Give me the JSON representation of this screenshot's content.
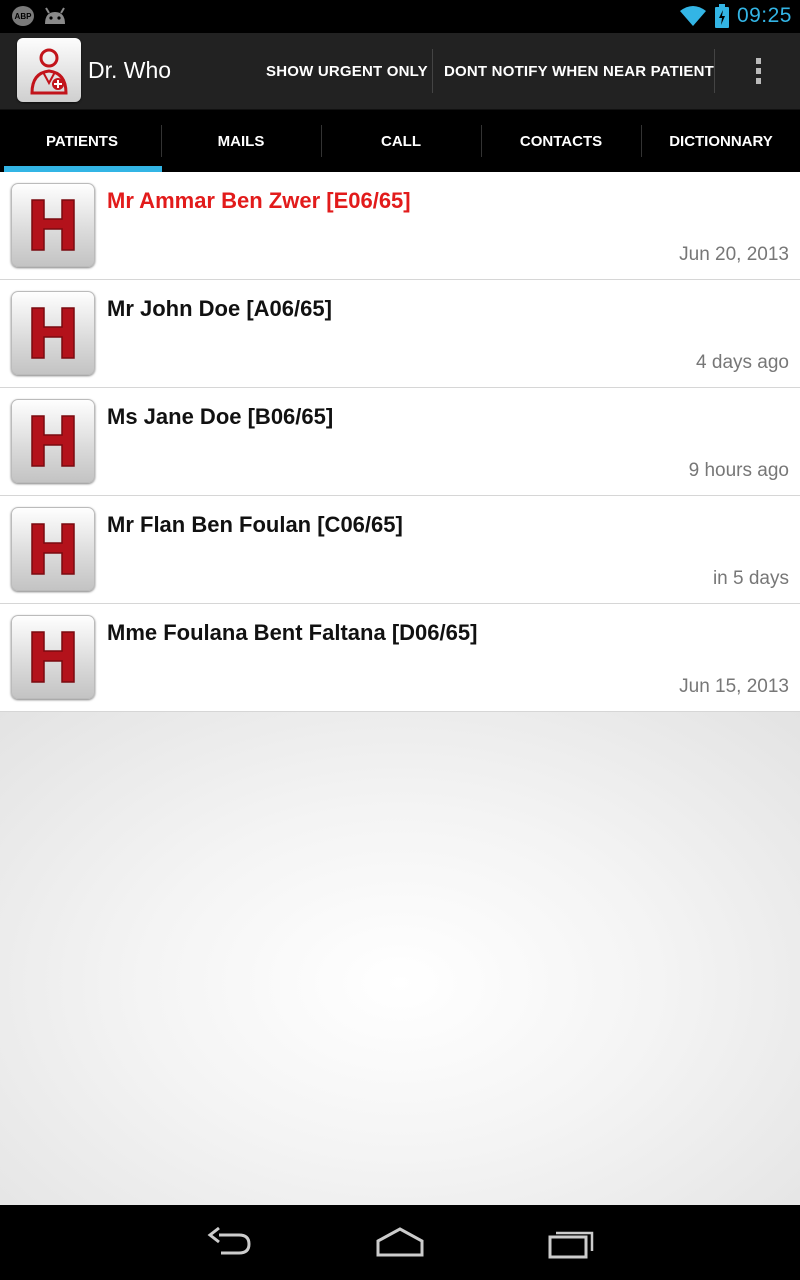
{
  "status_bar": {
    "left_icons": [
      "abp-icon",
      "android-icon"
    ],
    "abp_text": "ABP",
    "right_icons": [
      "wifi-icon",
      "battery-charging-icon"
    ],
    "time": "09:25",
    "accent_color": "#33b5e5"
  },
  "action_bar": {
    "app_icon": "doctor-icon",
    "title": "Dr. Who",
    "actions": [
      {
        "label": "SHOW URGENT ONLY"
      },
      {
        "label": "DONT NOTIFY WHEN NEAR PATIENT"
      }
    ],
    "overflow_icon": "overflow-menu-icon"
  },
  "tabs": [
    {
      "label": "PATIENTS",
      "active": true
    },
    {
      "label": "MAILS",
      "active": false
    },
    {
      "label": "CALL",
      "active": false
    },
    {
      "label": "CONTACTS",
      "active": false
    },
    {
      "label": "DICTIONNARY",
      "active": false
    }
  ],
  "patients": [
    {
      "name": "Mr Ammar Ben Zwer [E06/65]",
      "date": "Jun 20, 2013",
      "urgent": true,
      "icon": "hospital-h-icon"
    },
    {
      "name": "Mr John Doe [A06/65]",
      "date": "4 days ago",
      "urgent": false,
      "icon": "hospital-h-icon"
    },
    {
      "name": "Ms Jane Doe [B06/65]",
      "date": "9 hours ago",
      "urgent": false,
      "icon": "hospital-h-icon"
    },
    {
      "name": "Mr Flan Ben Foulan [C06/65]",
      "date": "in 5 days",
      "urgent": false,
      "icon": "hospital-h-icon"
    },
    {
      "name": "Mme Foulana Bent Faltana [D06/65]",
      "date": "Jun 15, 2013",
      "urgent": false,
      "icon": "hospital-h-icon"
    }
  ],
  "colors": {
    "urgent": "#e21b1b",
    "h_icon": "#b3121b",
    "tab_indicator": "#33b5e5"
  },
  "nav_bar": {
    "buttons": [
      "back-icon",
      "home-icon",
      "recent-apps-icon"
    ]
  }
}
